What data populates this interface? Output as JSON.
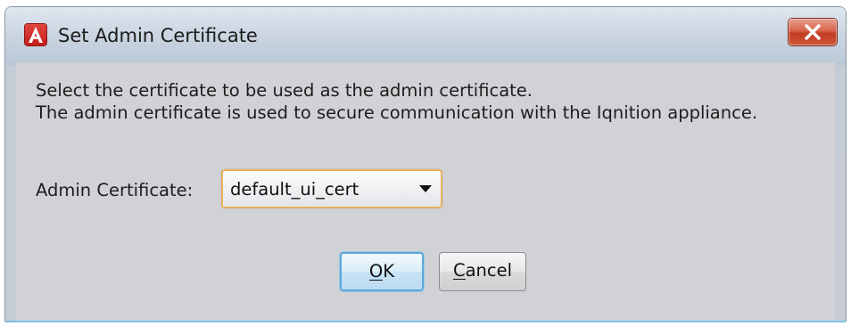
{
  "window": {
    "title": "Set Admin Certificate",
    "app_icon": "app-logo-a-icon",
    "app_icon_letter": "A",
    "close_icon": "close-icon"
  },
  "message": {
    "line1": "Select the certificate to be used as the admin certificate.",
    "line2": "The admin certificate is used to secure communication with the Iqnition appliance."
  },
  "form": {
    "label": "Admin Certificate:",
    "selected_value": "default_ui_cert",
    "dropdown_icon": "chevron-down-icon"
  },
  "buttons": {
    "ok_mnemonic": "O",
    "ok_rest": "K",
    "cancel_mnemonic": "C",
    "cancel_rest": "ancel"
  },
  "colors": {
    "title_icon": "#d12c27",
    "close_button": "#c9492f",
    "focus_border": "#e7b35a",
    "default_button_border": "#5aa8dc"
  }
}
